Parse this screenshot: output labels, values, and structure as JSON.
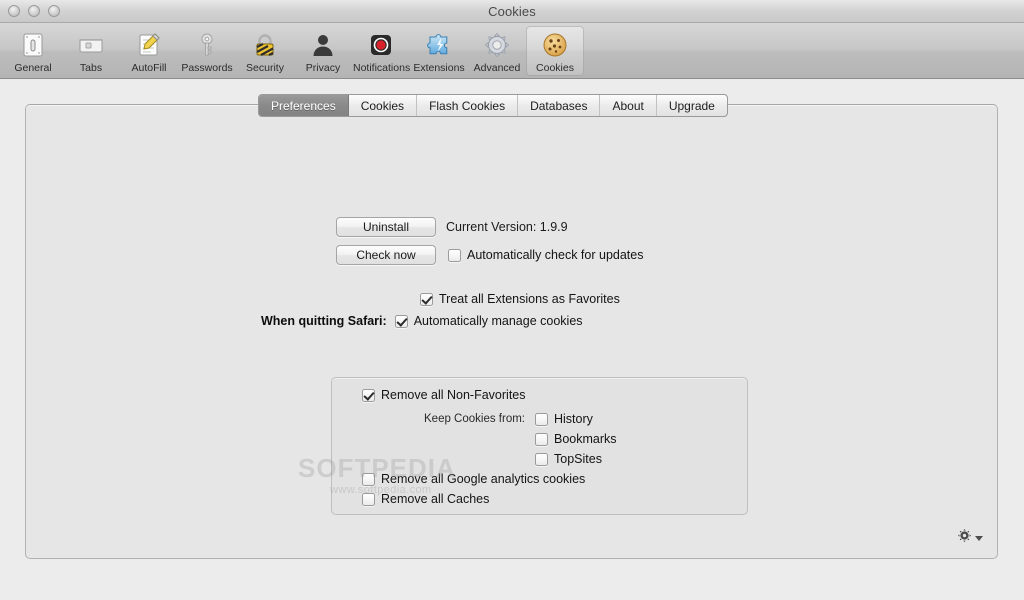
{
  "window": {
    "title": "Cookies",
    "traffic_lights": [
      "close",
      "minimize",
      "zoom"
    ]
  },
  "toolbar": {
    "items": [
      {
        "label": "General",
        "icon": "general-icon"
      },
      {
        "label": "Tabs",
        "icon": "tabs-icon"
      },
      {
        "label": "AutoFill",
        "icon": "autofill-icon"
      },
      {
        "label": "Passwords",
        "icon": "passwords-key-icon"
      },
      {
        "label": "Security",
        "icon": "security-lock-icon"
      },
      {
        "label": "Privacy",
        "icon": "privacy-person-icon"
      },
      {
        "label": "Notifications",
        "icon": "notifications-record-icon"
      },
      {
        "label": "Extensions",
        "icon": "extensions-puzzle-icon"
      },
      {
        "label": "Advanced",
        "icon": "advanced-gear-icon"
      },
      {
        "label": "Cookies",
        "icon": "cookies-cookie-icon",
        "selected": true
      }
    ]
  },
  "tabs": [
    {
      "label": "Preferences",
      "active": true
    },
    {
      "label": "Cookies",
      "active": false
    },
    {
      "label": "Flash Cookies",
      "active": false
    },
    {
      "label": "Databases",
      "active": false
    },
    {
      "label": "About",
      "active": false
    },
    {
      "label": "Upgrade",
      "active": false
    }
  ],
  "preferences": {
    "uninstall_button": "Uninstall",
    "version_text": "Current Version: 1.9.9",
    "check_now_button": "Check now",
    "auto_check_updates": {
      "label": "Automatically check for updates",
      "checked": false
    },
    "treat_extensions_favorites": {
      "label": "Treat all Extensions as Favorites",
      "checked": true
    },
    "when_quitting_label": "When quitting Safari:",
    "auto_manage_cookies": {
      "label": "Automatically manage cookies",
      "checked": true
    },
    "group": {
      "remove_non_favorites": {
        "label": "Remove all Non-Favorites",
        "checked": true
      },
      "keep_cookies_from_label": "Keep Cookies from:",
      "sources": [
        {
          "label": "History",
          "checked": false
        },
        {
          "label": "Bookmarks",
          "checked": false
        },
        {
          "label": "TopSites",
          "checked": false
        }
      ],
      "remove_google_analytics": {
        "label": "Remove all Google analytics cookies",
        "checked": false
      },
      "remove_caches": {
        "label": "Remove all Caches",
        "checked": false
      }
    }
  },
  "footer": {
    "action_menu_icon": "gear-icon",
    "action_menu_caret": "caret-down-icon"
  },
  "watermark": {
    "brand": "SOFTPEDIA",
    "url": "www.softpedia.com"
  },
  "colors": {
    "window_chrome": "#c6c6c6",
    "content_background": "#ececec",
    "panel_background": "#e6e6e6",
    "active_tab": "#8a8a8a",
    "text_primary": "#141414"
  }
}
